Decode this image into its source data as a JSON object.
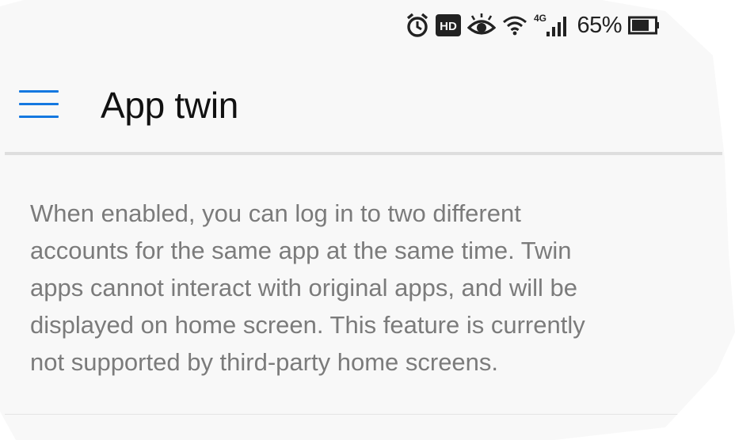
{
  "status_bar": {
    "icons": [
      "alarm-icon",
      "hd-icon",
      "eye-comfort-icon",
      "wifi-icon",
      "4g-signal-icon",
      "battery-icon"
    ],
    "network_label": "4G",
    "hd_label": "HD",
    "battery_percent": "65%"
  },
  "header": {
    "title": "App twin",
    "menu_icon": "hamburger-menu-icon",
    "accent_color": "#1478e0"
  },
  "content": {
    "description_lines": [
      "When enabled, you can log in to two different",
      "accounts for the same app at the same time. Twin",
      "apps cannot interact with original apps, and will be",
      "displayed on home screen. This feature is currently",
      "not supported by third-party home screens."
    ]
  }
}
